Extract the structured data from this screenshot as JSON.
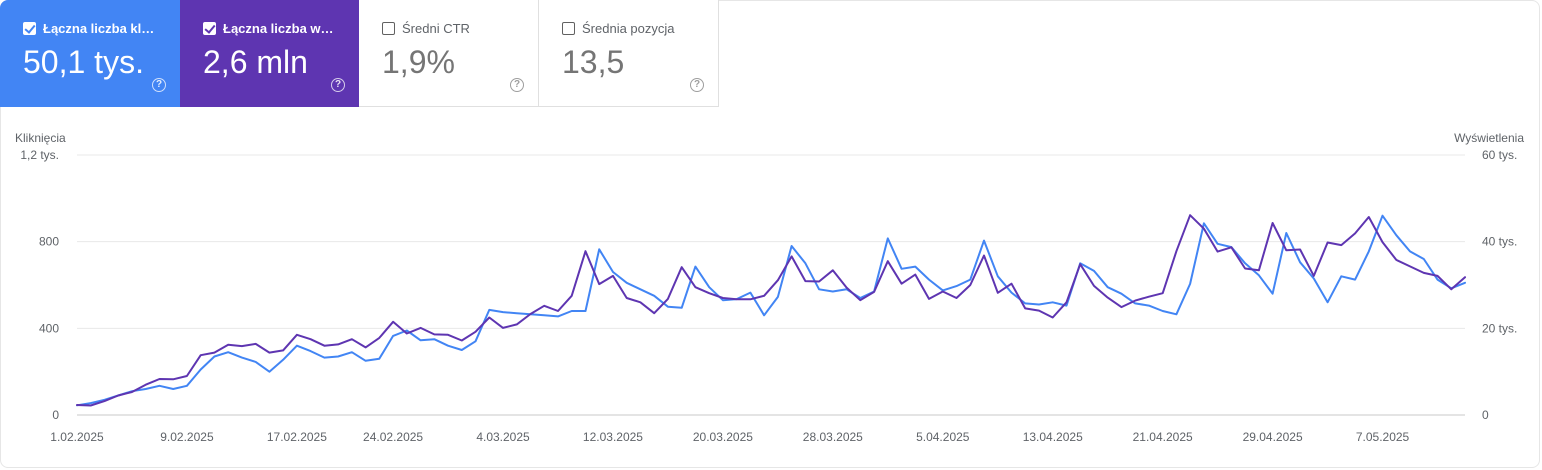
{
  "metrics": [
    {
      "key": "clicks",
      "label": "Łączna liczba kliknięć",
      "value": "50,1 tys.",
      "checked": true,
      "color": "#4285f4"
    },
    {
      "key": "impressions",
      "label": "Łączna liczba wyświetleń",
      "value": "2,6 mln",
      "checked": true,
      "color": "#5e35b1"
    },
    {
      "key": "ctr",
      "label": "Średni CTR",
      "value": "1,9%",
      "checked": false
    },
    {
      "key": "position",
      "label": "Średnia pozycja",
      "value": "13,5",
      "checked": false
    }
  ],
  "help_glyph": "?",
  "chart_data": {
    "type": "line",
    "left_axis": {
      "title": "Kliknięcia",
      "ticks": [
        "0",
        "400",
        "800",
        "1,2 tys."
      ],
      "range": [
        0,
        1200
      ]
    },
    "right_axis": {
      "title": "Wyświetlenia",
      "ticks": [
        "0",
        "20 tys.",
        "40 tys.",
        "60 tys."
      ],
      "range": [
        0,
        60000
      ]
    },
    "x_labels": [
      "1.02.2025",
      "9.02.2025",
      "17.02.2025",
      "24.02.2025",
      "4.03.2025",
      "12.03.2025",
      "20.03.2025",
      "28.03.2025",
      "5.04.2025",
      "13.04.2025",
      "21.04.2025",
      "29.04.2025",
      "7.05.2025"
    ],
    "x_label_index": [
      0,
      8,
      16,
      23,
      31,
      39,
      47,
      55,
      63,
      71,
      79,
      87,
      95
    ],
    "grid": true,
    "series": [
      {
        "name": "Kliknięcia",
        "axis": "left",
        "color": "#4285f4",
        "values": [
          45,
          55,
          70,
          90,
          110,
          120,
          135,
          120,
          135,
          210,
          270,
          290,
          265,
          245,
          200,
          255,
          320,
          295,
          265,
          270,
          290,
          250,
          260,
          365,
          390,
          345,
          350,
          320,
          300,
          340,
          485,
          475,
          470,
          465,
          460,
          455,
          480,
          480,
          765,
          660,
          610,
          580,
          550,
          500,
          495,
          685,
          590,
          530,
          535,
          565,
          460,
          545,
          780,
          700,
          580,
          570,
          580,
          540,
          570,
          815,
          675,
          685,
          625,
          575,
          595,
          625,
          805,
          640,
          565,
          515,
          510,
          520,
          505,
          700,
          665,
          590,
          560,
          515,
          505,
          480,
          465,
          605,
          885,
          790,
          775,
          700,
          645,
          560,
          840,
          705,
          630,
          520,
          640,
          625,
          755,
          920,
          830,
          755,
          720,
          625,
          585,
          610
        ]
      },
      {
        "name": "Wyświetlenia",
        "axis": "right",
        "color": "#5e35b1",
        "values": [
          2300,
          2200,
          3200,
          4500,
          5300,
          7000,
          8300,
          8250,
          9000,
          13800,
          14400,
          16200,
          15900,
          16400,
          14400,
          14900,
          18500,
          17500,
          16000,
          16300,
          17500,
          15600,
          17800,
          21500,
          18800,
          20100,
          18600,
          18500,
          17200,
          19200,
          22500,
          20100,
          20900,
          23300,
          25200,
          24000,
          27500,
          37800,
          30200,
          32100,
          27000,
          26000,
          23500,
          26800,
          34100,
          29500,
          28100,
          27000,
          26700,
          26700,
          27500,
          31100,
          36600,
          30900,
          30800,
          33400,
          29400,
          26500,
          28400,
          35500,
          30300,
          32400,
          26800,
          28500,
          27000,
          30000,
          36800,
          28200,
          30300,
          24600,
          24100,
          22500,
          26000,
          34800,
          29800,
          27100,
          24900,
          26400,
          27300,
          28100,
          37800,
          46100,
          43000,
          37700,
          38700,
          33800,
          33400,
          44300,
          38000,
          38200,
          32100,
          39800,
          39200,
          41900,
          45700,
          39900,
          35800,
          34300,
          32800,
          32100,
          29000,
          31800
        ]
      }
    ]
  }
}
